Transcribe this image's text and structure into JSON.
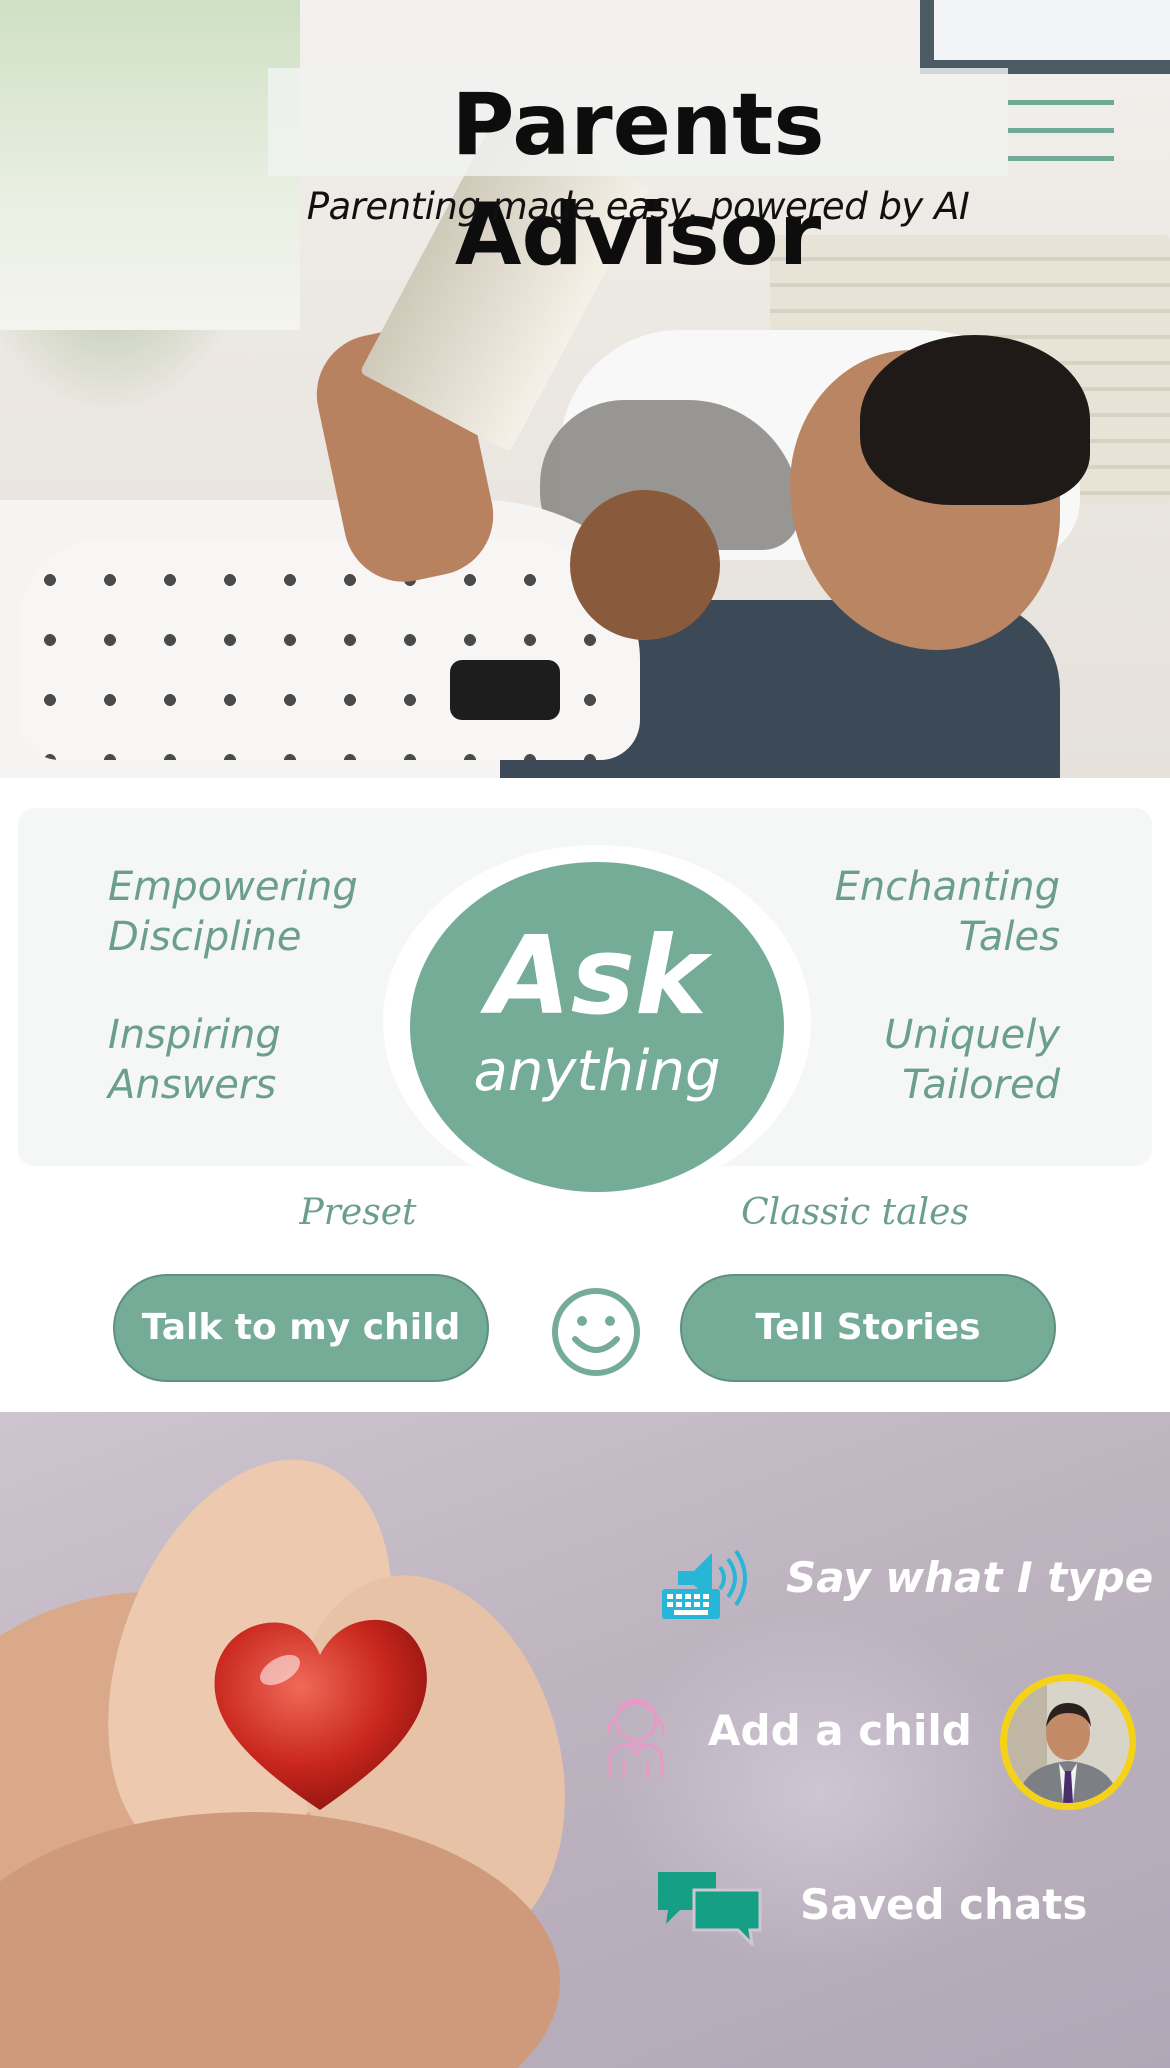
{
  "header": {
    "title": "Parents Advisor",
    "subtitle": "Parenting made easy, powered by AI",
    "menu_icon": "hamburger-menu-icon"
  },
  "features": {
    "left": [
      "Empowering Discipline",
      "Inspiring Answers"
    ],
    "right": [
      "Enchanting Tales",
      "Uniquely Tailored"
    ],
    "left_lines": [
      [
        "Empowering",
        "Discipline"
      ],
      [
        "Inspiring",
        "Answers"
      ]
    ],
    "right_lines": [
      [
        "Enchanting",
        "Tales"
      ],
      [
        "Uniquely",
        "Tailored"
      ]
    ]
  },
  "ask": {
    "line1": "Ask",
    "line2": "anything"
  },
  "actions": {
    "preset_caption": "Preset",
    "classic_caption": "Classic tales",
    "talk_button": "Talk to my child",
    "stories_button": "Tell Stories",
    "smiley_icon": "smiley-face-icon"
  },
  "options": {
    "say": {
      "label": "Say what I type",
      "icon": "keyboard-speaker-icon"
    },
    "child": {
      "label": "Add a child",
      "icon": "child-outline-icon"
    },
    "saved": {
      "label": "Saved chats",
      "icon": "chat-bubbles-icon"
    },
    "avatar_icon": "user-avatar-icon"
  },
  "colors": {
    "accent": "#74ac98",
    "feature_text": "#6b9e8d",
    "cyan_icon": "#27b5d8",
    "pink_icon": "#e89ac6",
    "teal_icon": "#15a085",
    "avatar_ring": "#f4d21a"
  }
}
